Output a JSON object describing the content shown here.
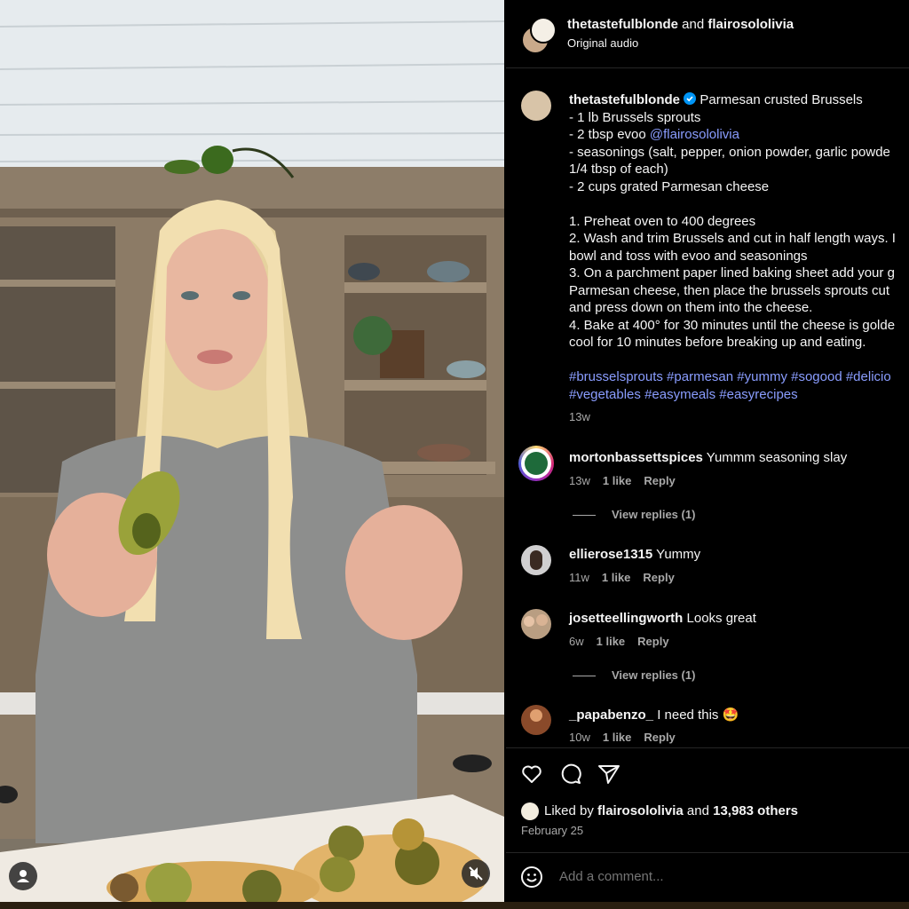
{
  "header": {
    "author": "thetastefulblonde",
    "joiner": " and ",
    "collaborator": "flairosololivia",
    "audio": "Original audio"
  },
  "caption": {
    "username": "thetastefulblonde",
    "title": " Parmesan crusted Brussels",
    "lines": [
      "- 1 lb Brussels sprouts",
      "- 2 tbsp evoo ",
      "- seasonings (salt, pepper, onion powder, garlic powde",
      "1/4 tbsp of each)",
      "- 2 cups grated Parmesan cheese",
      "",
      "1. Preheat oven to 400 degrees",
      "2. Wash and trim Brussels and cut in half length ways. I",
      "bowl and toss with evoo and seasonings",
      "3. On a parchment paper lined baking sheet add your g",
      "Parmesan cheese, then place the brussels sprouts cut",
      "and press down on them into the cheese.",
      "4. Bake at 400° for 30 minutes until the cheese is golde",
      "cool for 10 minutes before breaking up and eating.",
      ""
    ],
    "mention": "@flairosololivia",
    "hashtags_line1": "#brusselsprouts #parmesan #yummy #sogood #delicio",
    "hashtags_line2": "#vegetables #easymeals #easyrecipes",
    "age": "13w"
  },
  "comments": [
    {
      "username": "mortonbassettspices",
      "text": " Yummm seasoning slay",
      "age": "13w",
      "likes": "1 like",
      "reply": "Reply",
      "view_replies": "View replies (1)"
    },
    {
      "username": "ellierose1315",
      "text": " Yummy",
      "age": "11w",
      "likes": "1 like",
      "reply": "Reply"
    },
    {
      "username": "josetteellingworth",
      "text": " Looks great",
      "age": "6w",
      "likes": "1 like",
      "reply": "Reply",
      "view_replies": "View replies (1)"
    },
    {
      "username": "_papabenzo_",
      "text": " I need this 🤩",
      "age": "10w",
      "likes": "1 like",
      "reply": "Reply"
    }
  ],
  "footer": {
    "liked_prefix": "Liked by ",
    "liked_user": "flairosololivia",
    "liked_mid": " and ",
    "liked_others": "13,983 others",
    "date": "February 25",
    "add_comment_placeholder": "Add a comment..."
  },
  "icons": {
    "like": "heart-icon",
    "comment": "comment-bubble-icon",
    "share": "paper-plane-icon",
    "emoji": "smiley-icon",
    "verified": "verified-badge-icon",
    "user": "user-tag-icon",
    "mute": "mute-icon"
  },
  "colors": {
    "background": "#000000",
    "link": "#8a9dff",
    "verified": "#0095f6",
    "secondary_text": "#a8a8a8"
  }
}
